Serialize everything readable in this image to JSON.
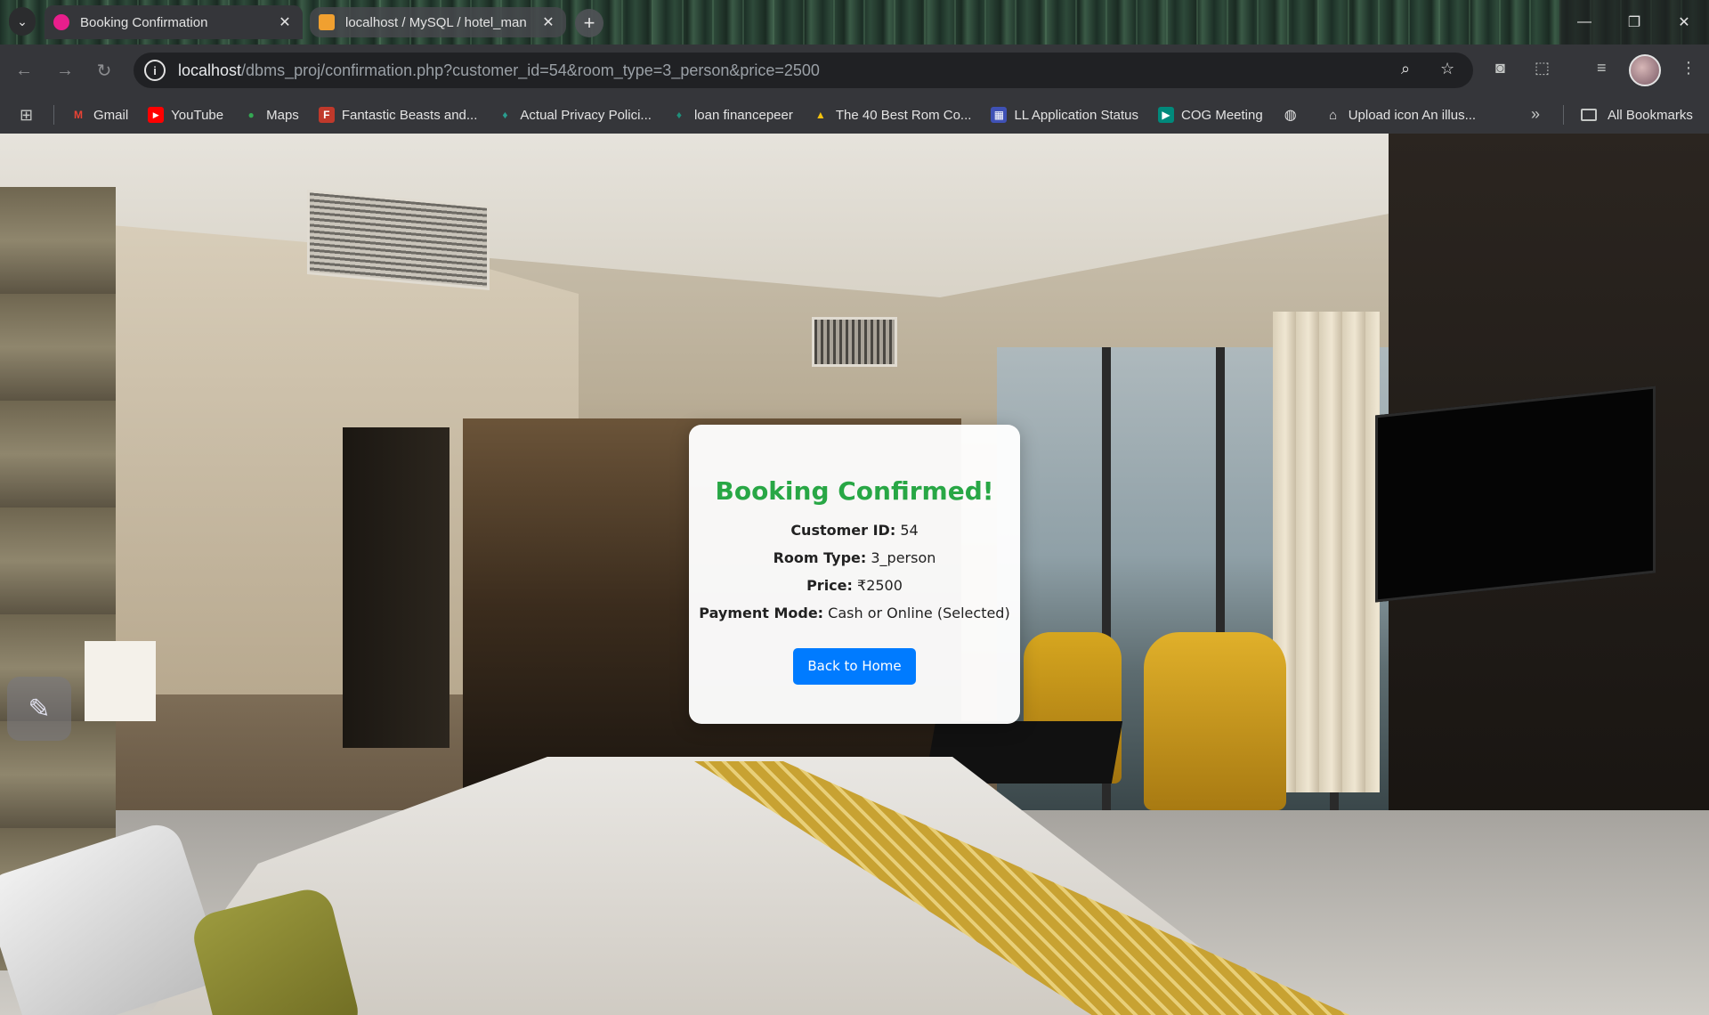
{
  "browser": {
    "tabs": [
      {
        "title": "Booking Confirmation",
        "active": true,
        "favicon_color": "#e91e8c"
      },
      {
        "title": "localhost / MySQL / hotel_man",
        "active": false,
        "favicon_color": "#f0a030"
      }
    ],
    "address": {
      "host": "localhost",
      "path": "/dbms_proj/confirmation.php?customer_id=54&room_type=3_person&price=2500"
    },
    "bookmarks": [
      {
        "label": "Gmail",
        "icon": "gmail-icon",
        "color": "#ea4335"
      },
      {
        "label": "YouTube",
        "icon": "youtube-icon",
        "color": "#ff0000"
      },
      {
        "label": "Maps",
        "icon": "maps-icon",
        "color": "#34a853"
      },
      {
        "label": "Fantastic Beasts and...",
        "icon": "fandom-icon",
        "color": "#c0392b"
      },
      {
        "label": "Actual Privacy Polici...",
        "icon": "leaf-icon",
        "color": "#2a9d8f"
      },
      {
        "label": "loan financepeer",
        "icon": "leaf-icon",
        "color": "#1f8f7a"
      },
      {
        "label": "The 40 Best Rom Co...",
        "icon": "warning-icon",
        "color": "#f4c20d"
      },
      {
        "label": "LL Application Status",
        "icon": "building-icon",
        "color": "#3f51b5"
      },
      {
        "label": "COG Meeting",
        "icon": "meet-icon",
        "color": "#00897b"
      },
      {
        "label": "",
        "icon": "globe-icon",
        "color": "#e3e3e3"
      },
      {
        "label": "Upload icon An illus...",
        "icon": "museum-icon",
        "color": "#e3e3e3"
      }
    ],
    "all_bookmarks_label": "All Bookmarks"
  },
  "confirmation": {
    "heading": "Booking Confirmed!",
    "customer_id_label": "Customer ID:",
    "customer_id": "54",
    "room_type_label": "Room Type:",
    "room_type": "3_person",
    "price_label": "Price:",
    "price": "₹2500",
    "payment_mode_label": "Payment Mode:",
    "payment_mode": "Cash or Online (Selected)",
    "back_button": "Back to Home",
    "heading_color": "#28a745",
    "button_color": "#007bff"
  }
}
